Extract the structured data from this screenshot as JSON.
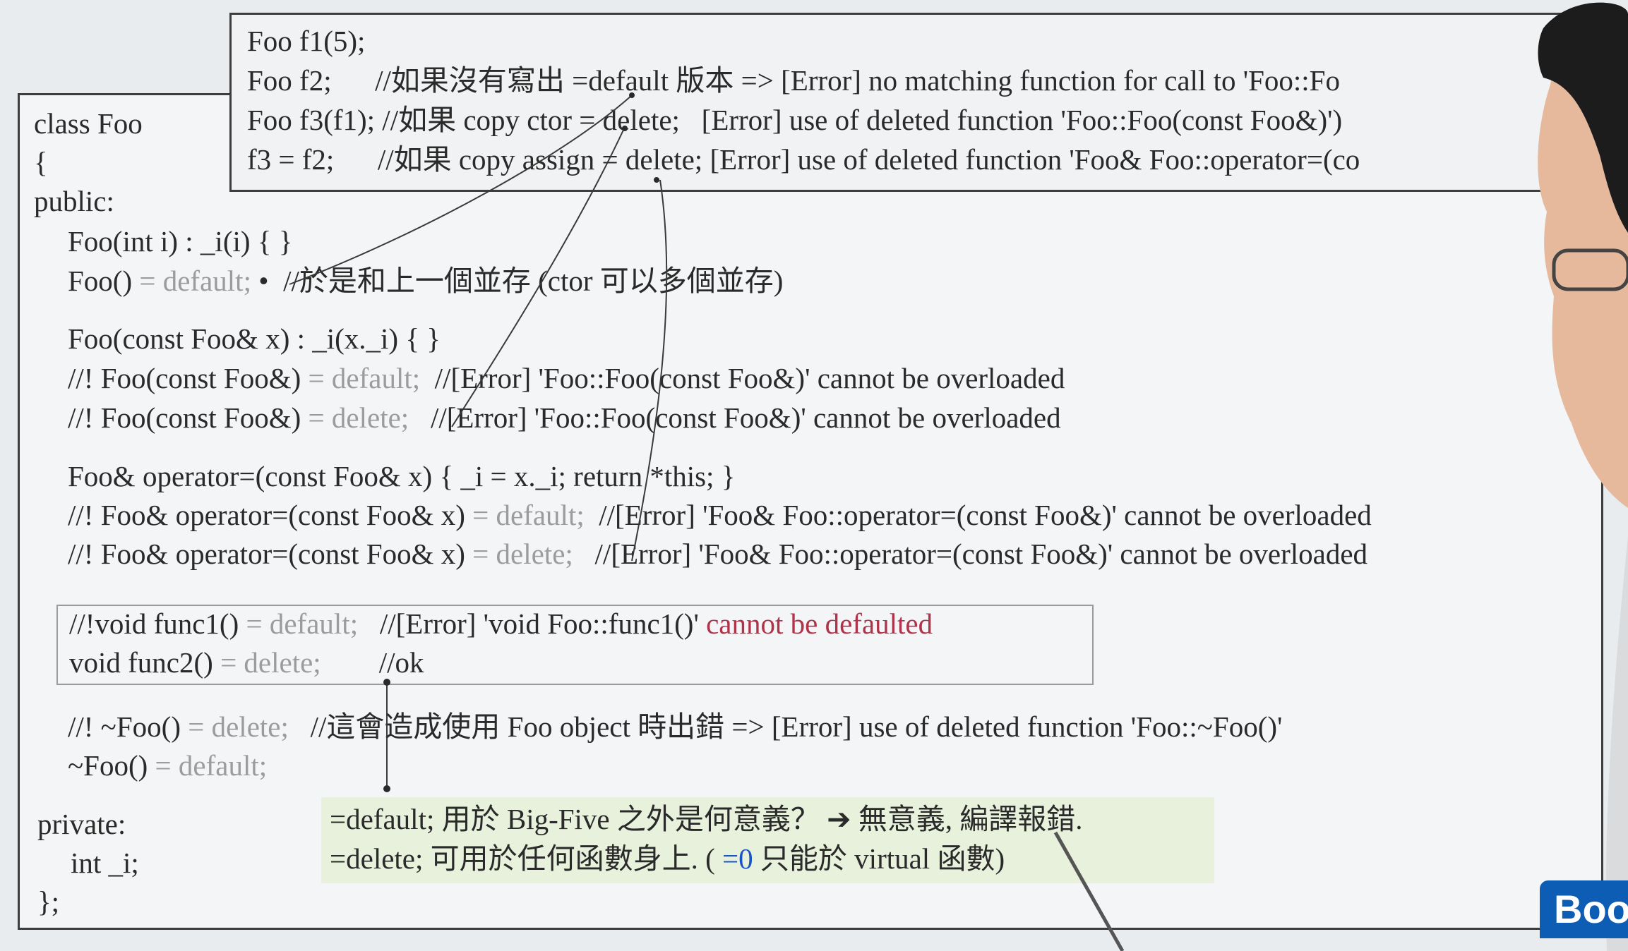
{
  "usage": [
    "Foo f1(5);",
    "Foo f2;      //如果沒有寫出 =default 版本 => [Error] no matching function for call to 'Foo::Fo",
    "Foo f3(f1); //如果 copy ctor = delete;   [Error] use of deleted function 'Foo::Foo(const Foo&)')",
    "f3 = f2;      //如果 copy assign = delete; [Error] use of deleted function 'Foo& Foo::operator=(co"
  ],
  "code": {
    "class_head": "class Foo",
    "brace_open": "{",
    "public": "public:",
    "ctor_int": "Foo(int i) : _i(i) { }",
    "default_ctor_a": "Foo() ",
    "default_ctor_b": "= default;",
    "default_ctor_c": " •  //於是和上一個並存 (ctor 可以多個並存)",
    "copy_ctor": "Foo(const Foo& x) : _i(x._i) { }",
    "copy_default_a": "//! Foo(const Foo&) ",
    "copy_default_b": "= default;",
    "copy_default_c": "  //[Error] 'Foo::Foo(const Foo&)' cannot be overloaded",
    "copy_delete_a": "//! Foo(const Foo&) ",
    "copy_delete_b": "= delete;",
    "copy_delete_c": "   //[Error] 'Foo::Foo(const Foo&)' cannot be overloaded",
    "assign": "Foo& operator=(const Foo& x) { _i = x._i; return *this; }",
    "assign_default_a": "//! Foo& operator=(const Foo& x) ",
    "assign_default_b": "= default;",
    "assign_default_c": "  //[Error] 'Foo& Foo::operator=(const Foo&)' cannot be overloaded",
    "assign_delete_a": "//! Foo& operator=(const Foo& x) ",
    "assign_delete_b": "= delete;",
    "assign_delete_c": "   //[Error] 'Foo& Foo::operator=(const Foo&)' cannot be overloaded",
    "func1_a": "//!void func1() ",
    "func1_b": "= default;",
    "func1_c": "   //[Error] 'void Foo::func1()' ",
    "func1_d": "cannot be defaulted",
    "func2_a": "void func2() ",
    "func2_b": "= delete;",
    "func2_c": "        //ok",
    "dtor_delete_a": "//! ~Foo() ",
    "dtor_delete_b": "= delete;",
    "dtor_delete_c": "   //這會造成使用 Foo object 時出錯 => [Error] use of deleted function 'Foo::~Foo()'",
    "dtor_default_a": "~Foo() ",
    "dtor_default_b": "= default;",
    "private": "private:",
    "member": "int _i;",
    "brace_close": "};"
  },
  "note": {
    "line1": "=default; 用於 Big-Five 之外是何意義？ ➔ 無意義, 編譯報錯.",
    "line2_a": "=delete; 可用於任何函數身上. ( ",
    "line2_b": "=0",
    "line2_c": " 只能於 virtual 函數)"
  },
  "logo": "Boo",
  "colors": {
    "background": "#e9ecef",
    "text": "#2a2a2a",
    "muted": "#9c9c9c",
    "error_red": "#b0334a",
    "note_green": "#e8f1dc",
    "logo_blue": "#0c5db3"
  }
}
